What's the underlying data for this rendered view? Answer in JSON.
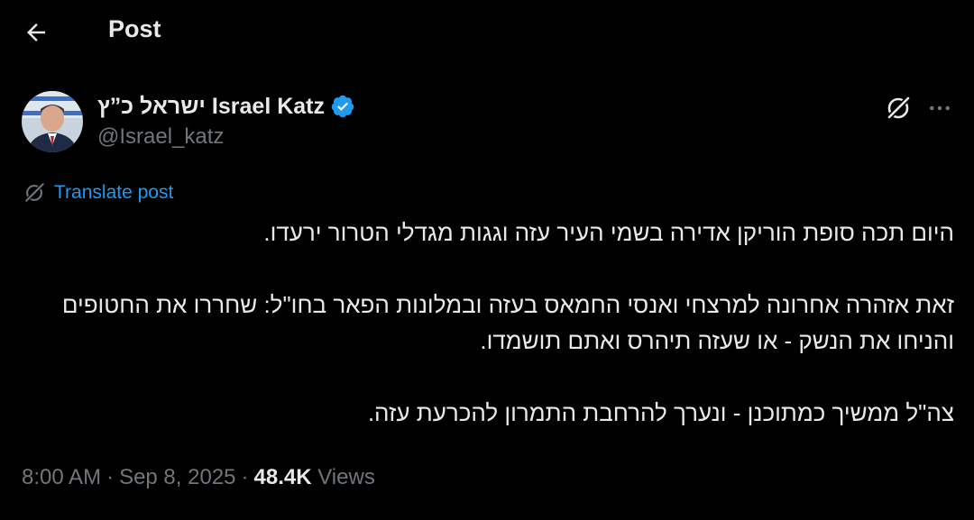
{
  "header": {
    "title": "Post"
  },
  "author": {
    "display_name": "ישראל כ”ץ Israel Katz",
    "handle": "@Israel_katz",
    "verified": true
  },
  "translate": {
    "label": "Translate post"
  },
  "post": {
    "paragraphs": [
      "היום תכה סופת הוריקן אדירה בשמי העיר עזה וגגות מגדלי הטרור ירעדו.",
      "זאת אזהרה אחרונה למרצחי ואנסי החמאס בעזה ובמלונות הפאר בחו\"ל: שחררו את החטופים והניחו את הנשק - או שעזה תיהרס ואתם תושמדו.",
      "צה\"ל ממשיך כמתוכנן - ונערך להרחבת התמרון להכרעת עזה."
    ]
  },
  "meta": {
    "time": "8:00 AM",
    "date": "Sep 8, 2025",
    "separator": "·",
    "views_count": "48.4K",
    "views_label": "Views"
  },
  "icons": {
    "back": "arrow-left-icon",
    "verified": "verified-badge-icon",
    "grok": "grok-icon",
    "more": "more-horizontal-icon",
    "translate": "grok-translate-icon"
  },
  "colors": {
    "background": "#000000",
    "text": "#e7e9ea",
    "muted": "#71767b",
    "accent": "#1d9bf0"
  }
}
